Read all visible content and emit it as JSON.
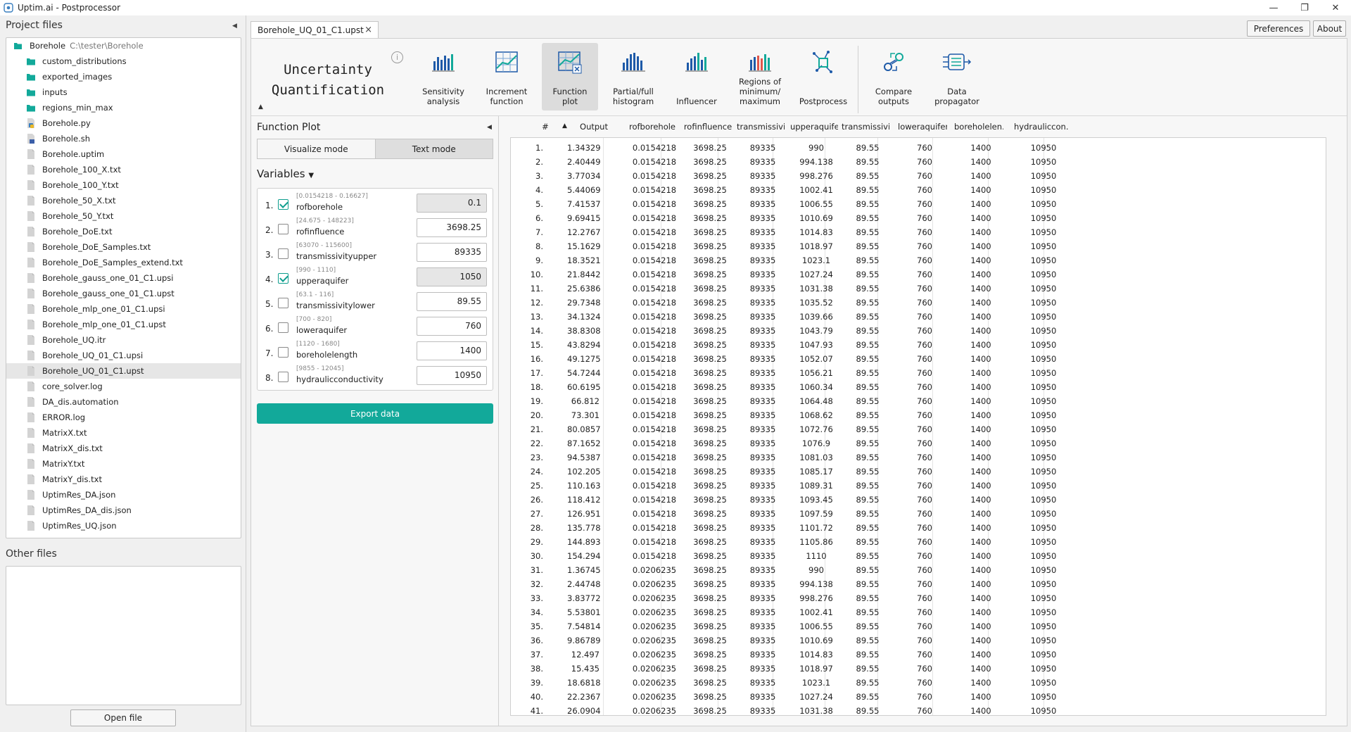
{
  "window": {
    "title": "Uptim.ai - Postprocessor",
    "controls": [
      "—",
      "❐",
      "✕"
    ]
  },
  "top_buttons": {
    "preferences": "Preferences",
    "about": "About"
  },
  "left": {
    "project_files_title": "Project files",
    "root": {
      "name": "Borehole",
      "path": "C:\\tester\\Borehole"
    },
    "items": [
      {
        "name": "custom_distributions",
        "type": "folder"
      },
      {
        "name": "exported_images",
        "type": "folder"
      },
      {
        "name": "inputs",
        "type": "folder"
      },
      {
        "name": "regions_min_max",
        "type": "folder"
      },
      {
        "name": "Borehole.py",
        "type": "py"
      },
      {
        "name": "Borehole.sh",
        "type": "sh"
      },
      {
        "name": "Borehole.uptim",
        "type": "file"
      },
      {
        "name": "Borehole_100_X.txt",
        "type": "file"
      },
      {
        "name": "Borehole_100_Y.txt",
        "type": "file"
      },
      {
        "name": "Borehole_50_X.txt",
        "type": "file"
      },
      {
        "name": "Borehole_50_Y.txt",
        "type": "file"
      },
      {
        "name": "Borehole_DoE.txt",
        "type": "file"
      },
      {
        "name": "Borehole_DoE_Samples.txt",
        "type": "file"
      },
      {
        "name": "Borehole_DoE_Samples_extend.txt",
        "type": "file"
      },
      {
        "name": "Borehole_gauss_one_01_C1.upsi",
        "type": "file"
      },
      {
        "name": "Borehole_gauss_one_01_C1.upst",
        "type": "file"
      },
      {
        "name": "Borehole_mlp_one_01_C1.upsi",
        "type": "file"
      },
      {
        "name": "Borehole_mlp_one_01_C1.upst",
        "type": "file"
      },
      {
        "name": "Borehole_UQ.itr",
        "type": "file"
      },
      {
        "name": "Borehole_UQ_01_C1.upsi",
        "type": "file"
      },
      {
        "name": "Borehole_UQ_01_C1.upst",
        "type": "file",
        "selected": true
      },
      {
        "name": "core_solver.log",
        "type": "file"
      },
      {
        "name": "DA_dis.automation",
        "type": "file"
      },
      {
        "name": "ERROR.log",
        "type": "file"
      },
      {
        "name": "MatrixX.txt",
        "type": "file"
      },
      {
        "name": "MatrixX_dis.txt",
        "type": "file"
      },
      {
        "name": "MatrixY.txt",
        "type": "file"
      },
      {
        "name": "MatrixY_dis.txt",
        "type": "file"
      },
      {
        "name": "UptimRes_DA.json",
        "type": "file"
      },
      {
        "name": "UptimRes_DA_dis.json",
        "type": "file"
      },
      {
        "name": "UptimRes_UQ.json",
        "type": "file"
      }
    ],
    "other_files_title": "Other files",
    "open_file": "Open file"
  },
  "tab": {
    "label": "Borehole_UQ_01_C1.upst",
    "close": "×"
  },
  "toolbar": {
    "title_line1": "Uncertainty",
    "title_line2": "Quantification",
    "info": "i",
    "tools": [
      {
        "label": "Sensitivity\nanalysis",
        "icon": "sensitivity-icon"
      },
      {
        "label": "Increment\nfunction",
        "icon": "increment-icon"
      },
      {
        "label": "Function\nplot",
        "icon": "function-plot-icon",
        "active": true
      },
      {
        "label": "Partial/full\nhistogram",
        "icon": "histogram-icon"
      },
      {
        "label": "Influencer",
        "icon": "influencer-icon"
      },
      {
        "label": "Regions of\nminimum/\nmaximum",
        "icon": "regions-icon"
      },
      {
        "label": "Postprocess",
        "icon": "postprocess-icon"
      },
      {
        "label": "Compare\noutputs",
        "icon": "compare-icon"
      },
      {
        "label": "Data\npropagator",
        "icon": "data-propagator-icon"
      }
    ]
  },
  "function_plot": {
    "title": "Function Plot",
    "modes": [
      "Visualize mode",
      "Text mode"
    ],
    "active_mode": "Text mode",
    "variables_title": "Variables",
    "variables": [
      {
        "num": "1.",
        "range": "[0.0154218 - 0.16627]",
        "name": "rofborehole",
        "value": "0.1",
        "checked": true
      },
      {
        "num": "2.",
        "range": "[24.675 - 148223]",
        "name": "rofinfluence",
        "value": "3698.25",
        "checked": false
      },
      {
        "num": "3.",
        "range": "[63070 - 115600]",
        "name": "transmissivityupper",
        "value": "89335",
        "checked": false
      },
      {
        "num": "4.",
        "range": "[990 - 1110]",
        "name": "upperaquifer",
        "value": "1050",
        "checked": true
      },
      {
        "num": "5.",
        "range": "[63.1 - 116]",
        "name": "transmissivitylower",
        "value": "89.55",
        "checked": false
      },
      {
        "num": "6.",
        "range": "[700 - 820]",
        "name": "loweraquifer",
        "value": "760",
        "checked": false
      },
      {
        "num": "7.",
        "range": "[1120 - 1680]",
        "name": "boreholelength",
        "value": "1400",
        "checked": false
      },
      {
        "num": "8.",
        "range": "[9855 - 12045]",
        "name": "hydraulicconductivity",
        "value": "10950",
        "checked": false
      }
    ],
    "export": "Export data"
  },
  "table": {
    "headers": [
      "#",
      "Output",
      "rofborehole",
      "rofinfluence",
      "transmissivit...",
      "upperaquifer",
      "transmissivit...",
      "loweraquifer",
      "boreholelen...",
      "hydraulіccon..."
    ],
    "sort_icon": "▲",
    "rows": [
      [
        "1.",
        "1.34329",
        "0.0154218",
        "3698.25",
        "89335",
        "990",
        "89.55",
        "760",
        "1400",
        "10950"
      ],
      [
        "2.",
        "2.40449",
        "0.0154218",
        "3698.25",
        "89335",
        "994.138",
        "89.55",
        "760",
        "1400",
        "10950"
      ],
      [
        "3.",
        "3.77034",
        "0.0154218",
        "3698.25",
        "89335",
        "998.276",
        "89.55",
        "760",
        "1400",
        "10950"
      ],
      [
        "4.",
        "5.44069",
        "0.0154218",
        "3698.25",
        "89335",
        "1002.41",
        "89.55",
        "760",
        "1400",
        "10950"
      ],
      [
        "5.",
        "7.41537",
        "0.0154218",
        "3698.25",
        "89335",
        "1006.55",
        "89.55",
        "760",
        "1400",
        "10950"
      ],
      [
        "6.",
        "9.69415",
        "0.0154218",
        "3698.25",
        "89335",
        "1010.69",
        "89.55",
        "760",
        "1400",
        "10950"
      ],
      [
        "7.",
        "12.2767",
        "0.0154218",
        "3698.25",
        "89335",
        "1014.83",
        "89.55",
        "760",
        "1400",
        "10950"
      ],
      [
        "8.",
        "15.1629",
        "0.0154218",
        "3698.25",
        "89335",
        "1018.97",
        "89.55",
        "760",
        "1400",
        "10950"
      ],
      [
        "9.",
        "18.3521",
        "0.0154218",
        "3698.25",
        "89335",
        "1023.1",
        "89.55",
        "760",
        "1400",
        "10950"
      ],
      [
        "10.",
        "21.8442",
        "0.0154218",
        "3698.25",
        "89335",
        "1027.24",
        "89.55",
        "760",
        "1400",
        "10950"
      ],
      [
        "11.",
        "25.6386",
        "0.0154218",
        "3698.25",
        "89335",
        "1031.38",
        "89.55",
        "760",
        "1400",
        "10950"
      ],
      [
        "12.",
        "29.7348",
        "0.0154218",
        "3698.25",
        "89335",
        "1035.52",
        "89.55",
        "760",
        "1400",
        "10950"
      ],
      [
        "13.",
        "34.1324",
        "0.0154218",
        "3698.25",
        "89335",
        "1039.66",
        "89.55",
        "760",
        "1400",
        "10950"
      ],
      [
        "14.",
        "38.8308",
        "0.0154218",
        "3698.25",
        "89335",
        "1043.79",
        "89.55",
        "760",
        "1400",
        "10950"
      ],
      [
        "15.",
        "43.8294",
        "0.0154218",
        "3698.25",
        "89335",
        "1047.93",
        "89.55",
        "760",
        "1400",
        "10950"
      ],
      [
        "16.",
        "49.1275",
        "0.0154218",
        "3698.25",
        "89335",
        "1052.07",
        "89.55",
        "760",
        "1400",
        "10950"
      ],
      [
        "17.",
        "54.7244",
        "0.0154218",
        "3698.25",
        "89335",
        "1056.21",
        "89.55",
        "760",
        "1400",
        "10950"
      ],
      [
        "18.",
        "60.6195",
        "0.0154218",
        "3698.25",
        "89335",
        "1060.34",
        "89.55",
        "760",
        "1400",
        "10950"
      ],
      [
        "19.",
        "66.812",
        "0.0154218",
        "3698.25",
        "89335",
        "1064.48",
        "89.55",
        "760",
        "1400",
        "10950"
      ],
      [
        "20.",
        "73.301",
        "0.0154218",
        "3698.25",
        "89335",
        "1068.62",
        "89.55",
        "760",
        "1400",
        "10950"
      ],
      [
        "21.",
        "80.0857",
        "0.0154218",
        "3698.25",
        "89335",
        "1072.76",
        "89.55",
        "760",
        "1400",
        "10950"
      ],
      [
        "22.",
        "87.1652",
        "0.0154218",
        "3698.25",
        "89335",
        "1076.9",
        "89.55",
        "760",
        "1400",
        "10950"
      ],
      [
        "23.",
        "94.5387",
        "0.0154218",
        "3698.25",
        "89335",
        "1081.03",
        "89.55",
        "760",
        "1400",
        "10950"
      ],
      [
        "24.",
        "102.205",
        "0.0154218",
        "3698.25",
        "89335",
        "1085.17",
        "89.55",
        "760",
        "1400",
        "10950"
      ],
      [
        "25.",
        "110.163",
        "0.0154218",
        "3698.25",
        "89335",
        "1089.31",
        "89.55",
        "760",
        "1400",
        "10950"
      ],
      [
        "26.",
        "118.412",
        "0.0154218",
        "3698.25",
        "89335",
        "1093.45",
        "89.55",
        "760",
        "1400",
        "10950"
      ],
      [
        "27.",
        "126.951",
        "0.0154218",
        "3698.25",
        "89335",
        "1097.59",
        "89.55",
        "760",
        "1400",
        "10950"
      ],
      [
        "28.",
        "135.778",
        "0.0154218",
        "3698.25",
        "89335",
        "1101.72",
        "89.55",
        "760",
        "1400",
        "10950"
      ],
      [
        "29.",
        "144.893",
        "0.0154218",
        "3698.25",
        "89335",
        "1105.86",
        "89.55",
        "760",
        "1400",
        "10950"
      ],
      [
        "30.",
        "154.294",
        "0.0154218",
        "3698.25",
        "89335",
        "1110",
        "89.55",
        "760",
        "1400",
        "10950"
      ],
      [
        "31.",
        "1.36745",
        "0.0206235",
        "3698.25",
        "89335",
        "990",
        "89.55",
        "760",
        "1400",
        "10950"
      ],
      [
        "32.",
        "2.44748",
        "0.0206235",
        "3698.25",
        "89335",
        "994.138",
        "89.55",
        "760",
        "1400",
        "10950"
      ],
      [
        "33.",
        "3.83772",
        "0.0206235",
        "3698.25",
        "89335",
        "998.276",
        "89.55",
        "760",
        "1400",
        "10950"
      ],
      [
        "34.",
        "5.53801",
        "0.0206235",
        "3698.25",
        "89335",
        "1002.41",
        "89.55",
        "760",
        "1400",
        "10950"
      ],
      [
        "35.",
        "7.54814",
        "0.0206235",
        "3698.25",
        "89335",
        "1006.55",
        "89.55",
        "760",
        "1400",
        "10950"
      ],
      [
        "36.",
        "9.86789",
        "0.0206235",
        "3698.25",
        "89335",
        "1010.69",
        "89.55",
        "760",
        "1400",
        "10950"
      ],
      [
        "37.",
        "12.497",
        "0.0206235",
        "3698.25",
        "89335",
        "1014.83",
        "89.55",
        "760",
        "1400",
        "10950"
      ],
      [
        "38.",
        "15.435",
        "0.0206235",
        "3698.25",
        "89335",
        "1018.97",
        "89.55",
        "760",
        "1400",
        "10950"
      ],
      [
        "39.",
        "18.6818",
        "0.0206235",
        "3698.25",
        "89335",
        "1023.1",
        "89.55",
        "760",
        "1400",
        "10950"
      ],
      [
        "40.",
        "22.2367",
        "0.0206235",
        "3698.25",
        "89335",
        "1027.24",
        "89.55",
        "760",
        "1400",
        "10950"
      ],
      [
        "41.",
        "26.0904",
        "0.0206235",
        "3698.25",
        "89335",
        "1031.38",
        "89.55",
        "760",
        "1400",
        "10950"
      ]
    ]
  },
  "colors": {
    "accent": "#12a99a",
    "folder": "#12a99a",
    "selected_row": "#e6e6e6",
    "tool_active": "#dcdcdc"
  }
}
